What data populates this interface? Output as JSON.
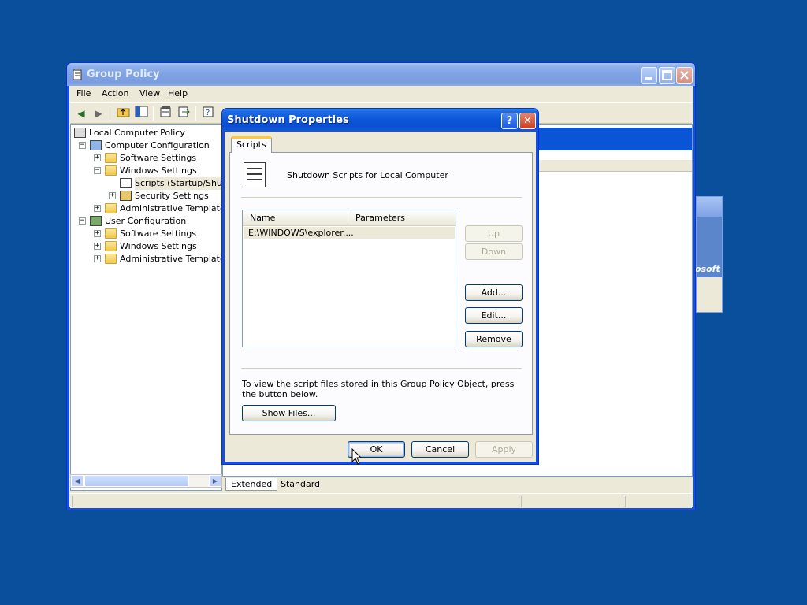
{
  "gp": {
    "title": "Group Policy",
    "menu": [
      "File",
      "Action",
      "View",
      "Help"
    ],
    "tree": [
      {
        "label": "Local Computer Policy",
        "level": 0,
        "expander": "",
        "icon": "policy-icon"
      },
      {
        "label": "Computer Configuration",
        "level": 1,
        "expander": "−",
        "icon": "computer-icon"
      },
      {
        "label": "Software Settings",
        "level": 2,
        "expander": "+",
        "icon": "folder-icon"
      },
      {
        "label": "Windows Settings",
        "level": 2,
        "expander": "−",
        "icon": "folder-icon"
      },
      {
        "label": "Scripts (Startup/Shutdown)",
        "level": 3,
        "expander": "",
        "icon": "script-icon"
      },
      {
        "label": "Security Settings",
        "level": 3,
        "expander": "+",
        "icon": "security-icon"
      },
      {
        "label": "Administrative Templates",
        "level": 2,
        "expander": "+",
        "icon": "folder-icon"
      },
      {
        "label": "User Configuration",
        "level": 1,
        "expander": "−",
        "icon": "user-icon"
      },
      {
        "label": "Software Settings",
        "level": 2,
        "expander": "+",
        "icon": "folder-icon"
      },
      {
        "label": "Windows Settings",
        "level": 2,
        "expander": "+",
        "icon": "folder-icon"
      },
      {
        "label": "Administrative Templates",
        "level": 2,
        "expander": "+",
        "icon": "folder-icon"
      }
    ],
    "view_tabs": {
      "extended": "Extended",
      "standard": "Standard"
    }
  },
  "bg_window": {
    "banner_text": "osoft"
  },
  "dialog": {
    "title": "Shutdown Properties",
    "help_glyph": "?",
    "close_glyph": "✕",
    "tab": "Scripts",
    "heading": "Shutdown Scripts for Local Computer",
    "columns": {
      "name": "Name",
      "parameters": "Parameters"
    },
    "rows": [
      {
        "name": "E:\\WINDOWS\\explorer....",
        "parameters": ""
      }
    ],
    "buttons": {
      "up": "Up",
      "down": "Down",
      "add": "Add...",
      "edit": "Edit...",
      "remove": "Remove",
      "show_files": "Show Files...",
      "ok": "OK",
      "cancel": "Cancel",
      "apply": "Apply"
    },
    "info_line1": "To view the script files stored in this Group Policy Object, press",
    "info_line2": "the button below."
  },
  "colors": {
    "desktop": "#0a4f9c",
    "selection": "#0a54d6",
    "titlebar": "#0a55d8"
  }
}
